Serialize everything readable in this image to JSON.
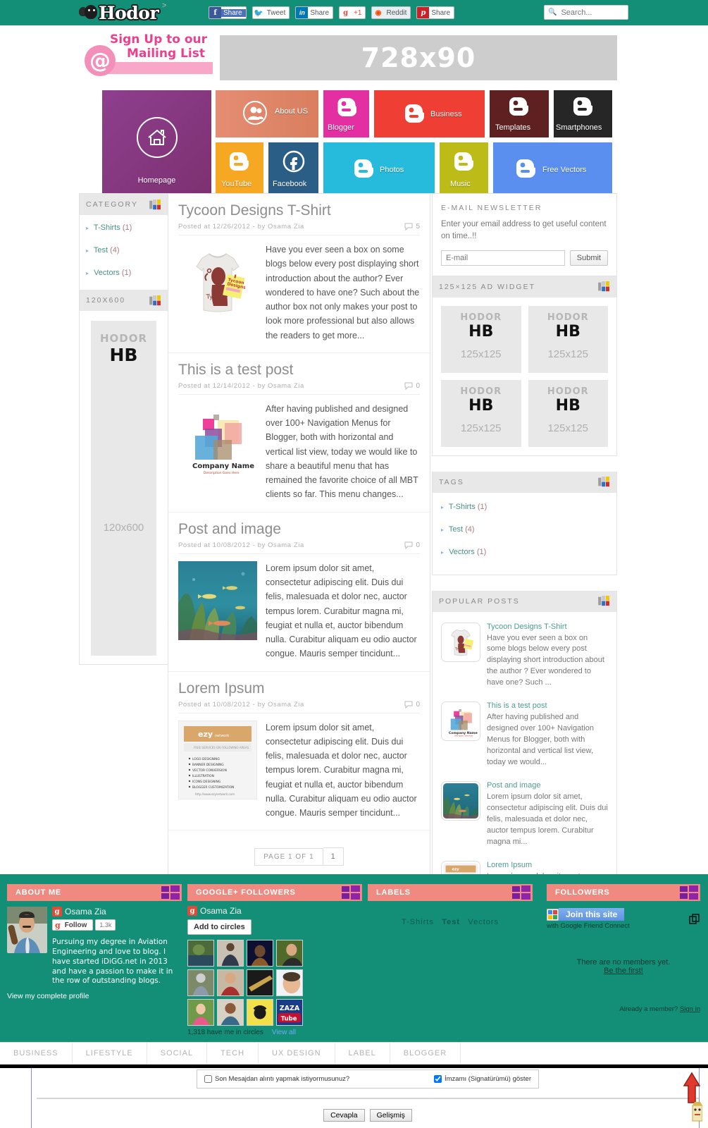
{
  "site": {
    "logo_text": "Hodor",
    "accent_green": "#148f77",
    "accent_pink": "#f08a80"
  },
  "header": {
    "share_buttons": [
      {
        "name": "facebook-share",
        "icon": "f",
        "label": "Share"
      },
      {
        "name": "twitter-tweet",
        "icon": "twitter-bird",
        "label": "Tweet"
      },
      {
        "name": "linkedin-share",
        "icon": "in",
        "label": "Share"
      },
      {
        "name": "google-plus-one",
        "icon": "g",
        "label": "+1"
      },
      {
        "name": "reddit-share",
        "icon": "reddit-alien",
        "label": "Reddit"
      },
      {
        "name": "pinterest-share",
        "icon": "p",
        "label": "Share"
      }
    ],
    "search": {
      "placeholder": "Search...",
      "value": "",
      "icon": "search-icon"
    }
  },
  "mailing": {
    "line1": "Sign Up to our",
    "line2": "Mailing List",
    "icon": "at-sign-icon"
  },
  "top_ad": {
    "label": "728x90"
  },
  "nav_tiles": [
    {
      "label": "Homepage",
      "icon": "home-icon",
      "color": "#8e3f8e"
    },
    {
      "label": "About US",
      "icon": "user-icon",
      "color": "#e58d73"
    },
    {
      "label": "Blogger",
      "icon": "blogger-icon",
      "color": "#e32fa2"
    },
    {
      "label": "Business",
      "icon": "blogger-icon",
      "color": "#ef3e33"
    },
    {
      "label": "Templates",
      "icon": "blogger-icon",
      "color": "#5e2020"
    },
    {
      "label": "Smartphones",
      "icon": "blogger-icon",
      "color": "#262626"
    },
    {
      "label": "YouTube",
      "icon": "blogger-icon",
      "color": "#f7a823"
    },
    {
      "label": "Facebook",
      "icon": "facebook-icon",
      "color": "#2b5e87"
    },
    {
      "label": "Photos",
      "icon": "blogger-icon",
      "color": "#26bbdd"
    },
    {
      "label": "Music",
      "icon": "blogger-icon",
      "color": "#bdbb18"
    },
    {
      "label": "Free Vectors",
      "icon": "blogger-icon",
      "color": "#5a8ff0"
    }
  ],
  "left_sidebar": {
    "category": {
      "title": "CATEGORY",
      "items": [
        {
          "label": "T-Shirts",
          "count": "(1)"
        },
        {
          "label": "Test",
          "count": "(4)"
        },
        {
          "label": "Vectors",
          "count": "(1)"
        }
      ]
    },
    "ad": {
      "title": "120X600",
      "brand": "HODOR",
      "mark": "HB",
      "size_label": "120x600"
    }
  },
  "posts": [
    {
      "title": "Tycoon Designs T-Shirt",
      "meta": "Posted at  12/26/2012 - by Osama Zia",
      "comments": "5",
      "excerpt": "Have you ever seen a box on some blogs below every post displaying short introduction about the author? Ever wondered to have one? Such about the author box not only makes your post to look more professional but also allows the readers to get more...",
      "thumb": "tshirt-tycoon-thumb"
    },
    {
      "title": "This is a test post",
      "meta": "Posted at  12/14/2012 - by Osama Zia",
      "comments": "0",
      "excerpt": "After having published and designed over 100+ Navigation Menus for Blogger, both with horizontal and vertical list view, today we would like to share a beautiful menu that has remained the favorite choice of all MBT clients so far. This menu changes...",
      "thumb": "company-name-logo-thumb"
    },
    {
      "title": "Post and image",
      "meta": "Posted at  10/08/2012 - by Osama Zia",
      "comments": "0",
      "excerpt": "Lorem ipsum dolor sit amet, consectetur adipiscing elit. Duis dui felis, malesuada et dolor nec, auctor tempus lorem. Curabitur magna mi, feugiat et nulla et, auctor bibendum nulla. Curabitur aliquam eu odio auctor congue. Mauris semper tincidunt...",
      "thumb": "underwater-fish-thumb"
    },
    {
      "title": "Lorem Ipsum",
      "meta": "Posted at  10/08/2012 - by Osama Zia",
      "comments": "0",
      "excerpt": "Lorem ipsum dolor sit amet, consectetur adipiscing elit. Duis dui felis, malesuada et dolor nec, auctor tempus lorem. Curabitur magna mi, feugiat et nulla et, auctor bibendum nulla. Curabitur aliquam eu odio auctor congue. Mauris semper tincidunt...",
      "thumb": "ezy-network-flyer-thumb"
    }
  ],
  "pager": {
    "info": "PAGE 1 OF 1",
    "current": "1"
  },
  "right_sidebar": {
    "newsletter": {
      "title": "E-MAIL NEWSLETTER",
      "description": "Enter your email address to get useful content on time..!!",
      "placeholder": "E-mail",
      "value": "",
      "submit_label": "Submit"
    },
    "ad_widget": {
      "title": "125×125 AD WIDGET",
      "ads": [
        {
          "brand": "HODOR",
          "mark": "HB",
          "size_label": "125x125"
        },
        {
          "brand": "HODOR",
          "mark": "HB",
          "size_label": "125x125"
        },
        {
          "brand": "HODOR",
          "mark": "HB",
          "size_label": "125x125"
        },
        {
          "brand": "HODOR",
          "mark": "HB",
          "size_label": "125x125"
        }
      ]
    },
    "tags": {
      "title": "TAGS",
      "items": [
        {
          "label": "T-Shirts",
          "count": "(1)"
        },
        {
          "label": "Test",
          "count": "(4)"
        },
        {
          "label": "Vectors",
          "count": "(1)"
        }
      ]
    },
    "popular": {
      "title": "POPULAR POSTS",
      "items": [
        {
          "title": "Tycoon Designs T-Shirt",
          "desc": "Have you ever seen a box on some blogs below every post displaying short introduction about the author ? Ever wondered to have one? Such ...",
          "thumb": "tshirt-tycoon-thumb"
        },
        {
          "title": "This is a test post",
          "desc": "After having published and designed over 100+ Navigation Menus for Blogger, both with horizontal and vertical list view, today we would...",
          "thumb": "company-name-logo-thumb"
        },
        {
          "title": "Post and image",
          "desc": "Lorem ipsum dolor sit amet, consectetur adipiscing elit. Duis dui felis, malesuada et dolor nec, auctor tempus lorem. Curabitur magna mi...",
          "thumb": "underwater-fish-thumb"
        },
        {
          "title": "Lorem Ipsum",
          "desc": "Lorem ipsum dolor sit amet, consectetur adipiscing elit. Duis dui felis, malesuada et dolor nec, auctor tempus lorem. Curabitur magna mi...",
          "thumb": "ezy-network-flyer-thumb"
        }
      ]
    }
  },
  "footer": {
    "about": {
      "title": "ABOUT ME",
      "profile_name": "Osama Zia",
      "follow_label": "Follow",
      "follow_count": "1.3k",
      "bio": "Pursuing my degree in Aviation Engineering and love to blog. I have started iDiGG.net in 2013 and have a passion to make it in the row of outstanding blogs.",
      "profile_link": "View my complete profile"
    },
    "gplus": {
      "title": "GOOGLE+ FOLLOWERS",
      "profile_name": "Osama Zia",
      "add_label": "Add to circles",
      "circles_count": "1,318 have me in circles",
      "view_all": "View all",
      "avatar_count": 12
    },
    "labels": {
      "title": "LABELS",
      "items": [
        "T-Shirts",
        "Test",
        "Vectors"
      ]
    },
    "followers": {
      "title": "FOLLOWERS",
      "join_label": "Join this site",
      "with_label": "with Google Friend Connect",
      "no_members": "There are no members yet.",
      "be_first": "Be the first!",
      "already_member": "Already a member?",
      "sign_in": "Sign in"
    }
  },
  "bottom_nav": [
    "BUSINESS",
    "LIFESTYLE",
    "SOCIAL",
    "TECH",
    "UX DESIGN",
    "LABEL",
    "BLOGGER"
  ],
  "reply_form": {
    "quote_label": "Son Mesajdan alıntı yapmak istiyormusunuz?",
    "quote_checked": false,
    "signature_label": "İmzamı (Signatürümü) göster",
    "signature_checked": true,
    "reply_button": "Cevapla",
    "advanced_button": "Gelişmiş"
  }
}
